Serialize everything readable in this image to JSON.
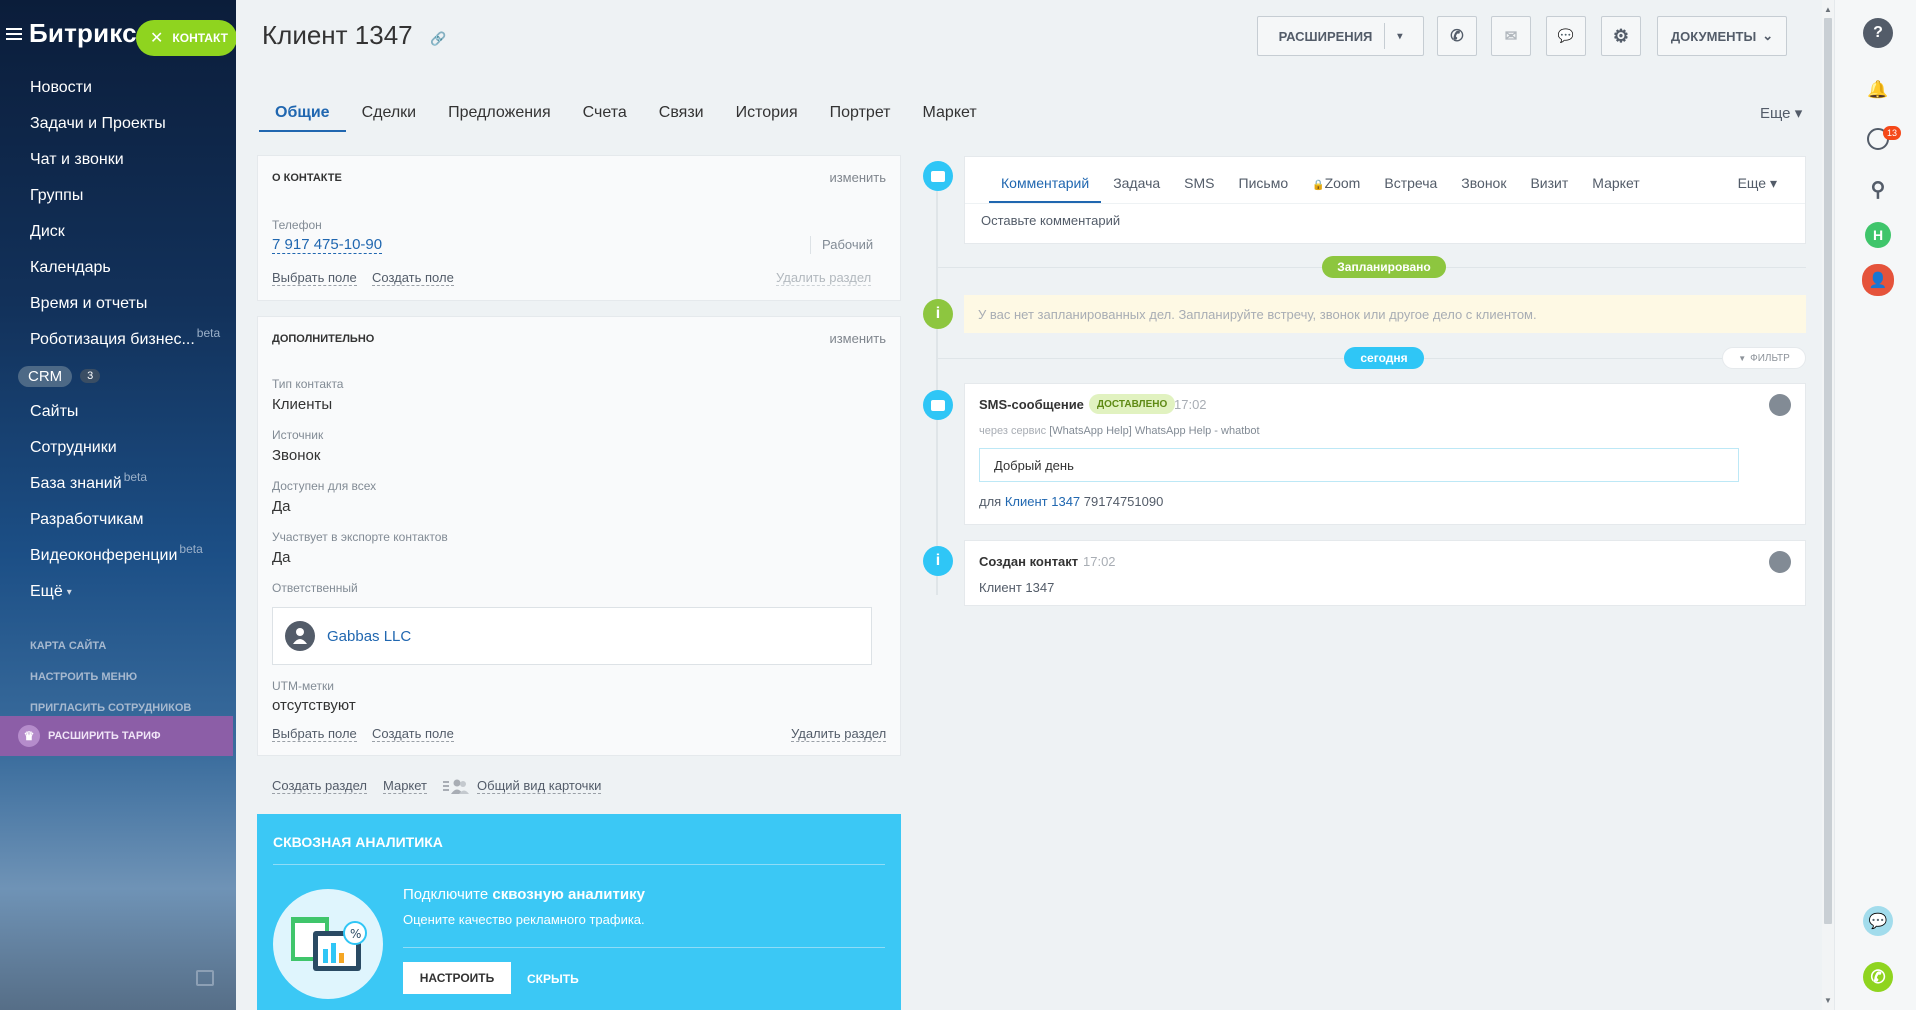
{
  "sidebar": {
    "logo": "Битрикс",
    "contact_pill": "КОНТАКТ",
    "close_glyph": "✕",
    "items": [
      {
        "label": "Новости"
      },
      {
        "label": "Задачи и Проекты"
      },
      {
        "label": "Чат и звонки"
      },
      {
        "label": "Группы"
      },
      {
        "label": "Диск"
      },
      {
        "label": "Календарь"
      },
      {
        "label": "Время и отчеты"
      },
      {
        "label": "Роботизация бизнес...",
        "sup": "beta"
      },
      {
        "label": "CRM",
        "count": "3"
      },
      {
        "label": "Сайты"
      },
      {
        "label": "Сотрудники"
      },
      {
        "label": "База знаний",
        "sup": "beta"
      },
      {
        "label": "Разработчикам"
      },
      {
        "label": "Видеоконференции",
        "sup": "beta"
      },
      {
        "label": "Ещё",
        "caret": "▾"
      }
    ],
    "small_links": [
      "КАРТА САЙТА",
      "НАСТРОИТЬ МЕНЮ",
      "ПРИГЛАСИТЬ СОТРУДНИКОВ"
    ],
    "upgrade": "РАСШИРИТЬ ТАРИФ",
    "upgrade_glyph": "♛",
    "printer_icon": "printer-icon"
  },
  "header": {
    "title": "Клиент 1347",
    "link_glyph": "🔗",
    "extensions": "РАСШИРЕНИЯ",
    "extensions_caret": "▾",
    "documents": "ДОКУМЕНТЫ",
    "documents_caret": "⌄",
    "phone_glyph": "✆",
    "mail_glyph": "✉",
    "chat_glyph": "💬",
    "gear_glyph": "⚙"
  },
  "tabs": {
    "items": [
      "Общие",
      "Сделки",
      "Предложения",
      "Счета",
      "Связи",
      "История",
      "Портрет",
      "Маркет"
    ],
    "more": "Еще ▾"
  },
  "about": {
    "title": "О КОНТАКТЕ",
    "edit": "изменить",
    "phone_label": "Телефон",
    "phone": "7 917 475-10-90",
    "phone_type": "Рабочий",
    "select_field": "Выбрать поле",
    "create_field": "Создать поле",
    "delete_section": "Удалить раздел"
  },
  "extra": {
    "title": "ДОПОЛНИТЕЛЬНО",
    "edit": "изменить",
    "fields": [
      {
        "label": "Тип контакта",
        "value": "Клиенты"
      },
      {
        "label": "Источник",
        "value": "Звонок"
      },
      {
        "label": "Доступен для всех",
        "value": "Да"
      },
      {
        "label": "Участвует в экспорте контактов",
        "value": "Да"
      }
    ],
    "responsible_label": "Ответственный",
    "responsible_name": "Gabbas LLC",
    "utm_label": "UTM-метки",
    "utm_value": "отсутствуют",
    "select_field": "Выбрать поле",
    "create_field": "Создать поле",
    "delete_section": "Удалить раздел"
  },
  "bottom_links": {
    "create_section": "Создать раздел",
    "market": "Маркет",
    "common_view": "Общий вид карточки"
  },
  "analytics": {
    "title": "СКВОЗНАЯ АНАЛИТИКА",
    "text_prefix": "Подключите ",
    "text_bold": "сквозную аналитику",
    "text2": "Оцените качество рекламного трафика.",
    "configure": "НАСТРОИТЬ",
    "hide": "СКРЫТЬ"
  },
  "editor": {
    "tabs": [
      "Комментарий",
      "Задача",
      "SMS",
      "Письмо",
      "Zoom",
      "Встреча",
      "Звонок",
      "Визит",
      "Маркет"
    ],
    "more": "Еще ▾",
    "placeholder": "Оставьте комментарий",
    "lock_glyph": "🔒"
  },
  "timeline": {
    "planned": "Запланировано",
    "no_planned": "У вас нет запланированных дел. Запланируйте встречу, звонок или другое дело с клиентом.",
    "today": "сегодня",
    "filter": "ФИЛЬТР",
    "filter_glyph": "▼",
    "info_glyph": "i",
    "sms": {
      "title": "SMS-сообщение",
      "status": "ДОСТАВЛЕНО",
      "time": "17:02",
      "via_prefix": "через сервис",
      "service": "[WhatsApp Help] WhatsApp Help - whatbot",
      "message": "Добрый день",
      "for_prefix": "для",
      "client": "Клиент 1347",
      "number": "79174751090"
    },
    "created": {
      "title": "Создан контакт",
      "time": "17:02",
      "client": "Клиент 1347"
    }
  },
  "rail": {
    "help_glyph": "?",
    "bell_glyph": "🔔",
    "notif_count": "13",
    "search_glyph": "⚲",
    "user_initial": "Н",
    "person_glyph": "👤",
    "phone_glyph": "✆",
    "chat_glyph": "💬"
  },
  "scroll": {
    "up": "▲",
    "down": "▼"
  },
  "colors": {
    "accent": "#2067b0",
    "contact_green": "#8fd41f",
    "planned_green": "#8dc63f",
    "today_blue": "#2fc6f6",
    "analytics_blue": "#3bc8f5",
    "upgrade_purple": "#8c5ea7"
  }
}
